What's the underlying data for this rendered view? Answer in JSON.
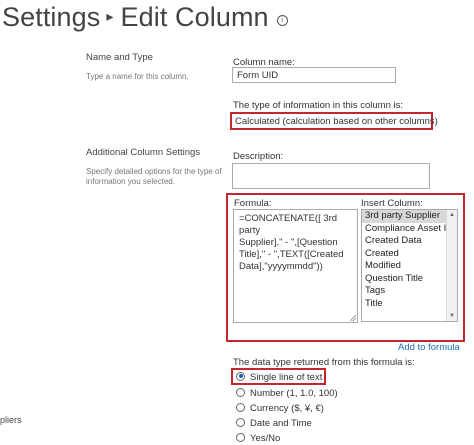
{
  "header": {
    "breadcrumb_root": "Settings",
    "separator": "▸",
    "title": "Edit Column",
    "info_glyph": "i"
  },
  "sections": {
    "name_type": {
      "title": "Name and Type",
      "description": "Type a name for this column."
    },
    "additional": {
      "title": "Additional Column Settings",
      "description_line1": "Specify detailed options for the type of",
      "description_line2": "information you selected."
    }
  },
  "column_name": {
    "label": "Column name:",
    "value": "Form UID"
  },
  "info_type": {
    "label": "The type of information in this column is:",
    "value": "Calculated (calculation based on other columns)"
  },
  "description_field": {
    "label": "Description:",
    "value": ""
  },
  "formula": {
    "label": "Formula:",
    "line1": "=CONCATENATE([ 3rd party",
    "line2": "Supplier],\" - \",[Question",
    "line3": "Title],\" - \",TEXT([Created",
    "line4": "Data],\"yyyymmdd\"))"
  },
  "insert_column": {
    "label": "Insert Column:",
    "items": [
      "3rd party Supplier",
      "Compliance Asset Id",
      "Created Data",
      "Created",
      "Modified",
      "Question Title",
      "Tags",
      "Title"
    ],
    "selected_index": 0,
    "add_link": "Add to formula"
  },
  "return_type": {
    "label": "The data type returned from this formula is:",
    "options": [
      "Single line of text",
      "Number (1, 1.0, 100)",
      "Currency ($, ¥, €)",
      "Date and Time",
      "Yes/No"
    ],
    "selected_index": 0
  },
  "left_edge_text": "pliers",
  "colors": {
    "highlight_border": "#c4262e",
    "link": "#1b6fb8"
  }
}
